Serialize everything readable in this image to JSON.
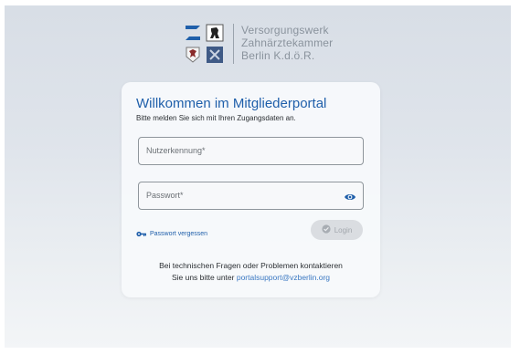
{
  "brand": {
    "line1": "Versorgungswerk",
    "line2": "Zahnärztekammer",
    "line3": "Berlin K.d.ö.R."
  },
  "login_card": {
    "title": "Willkommen im Mitgliederportal",
    "subtitle": "Bitte melden Sie sich mit Ihren Zugangsdaten an.",
    "username_placeholder": "Nutzerkennung*",
    "username_value": "",
    "password_placeholder": "Passwort*",
    "password_value": "",
    "forgot_label": "Passwort vergessen",
    "login_label": "Login",
    "help_line1": "Bei technischen Fragen oder Problemen kontaktieren",
    "help_line2_prefix": "Sie uns bitte unter",
    "help_email": "portalsupport@vzberlin.org"
  },
  "colors": {
    "accent": "#1f5faa",
    "link": "#3a78c2",
    "disabled_button": "#dadde1"
  },
  "icons": {
    "eye": "eye-icon",
    "key": "key-icon",
    "check": "check-circle-icon"
  }
}
